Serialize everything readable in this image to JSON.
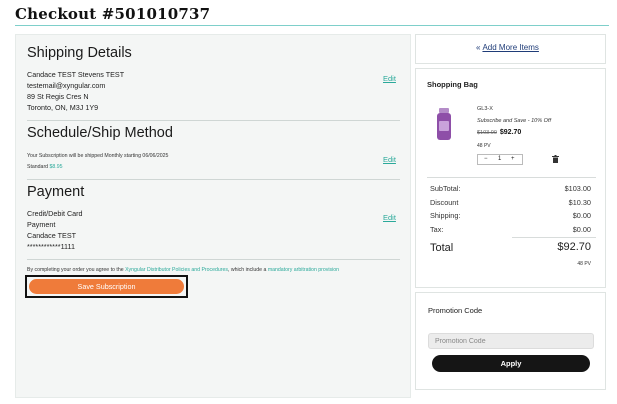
{
  "header": {
    "title": "Checkout #501010737"
  },
  "shipping": {
    "heading": "Shipping Details",
    "name": "Candace TEST Stevens TEST",
    "email": "testemail@xyngular.com",
    "street": "89 St Regis Cres N",
    "city": "Toronto, ON, M3J 1Y9",
    "edit_label": "Edit"
  },
  "schedule": {
    "heading": "Schedule/Ship Method",
    "note": "Your Subscription will be shipped Monthly starting 06/06/2025",
    "method_label": "Standard",
    "method_price": "$8.95",
    "edit_label": "Edit"
  },
  "payment": {
    "heading": "Payment",
    "type": "Credit/Debit Card",
    "label": "Payment",
    "name": "Candace TEST",
    "card": "************1111",
    "edit_label": "Edit"
  },
  "agreement": {
    "prefix": "By completing your order you agree to the",
    "link1": "Xyngular Distributor Policies and Procedures",
    "middle": ", which include a",
    "link2": "mandatory arbitration provision"
  },
  "save_button": "Save Subscription",
  "add_more": {
    "label": "Add More Items",
    "icon": "double-chevron-left-icon"
  },
  "bag": {
    "title": "Shopping Bag",
    "product": {
      "name": "GL3-X",
      "subtitle": "Subscribe and Save - 10% Off",
      "old_price": "$103.00",
      "price": "$92.70",
      "pv": "48 PV",
      "quantity": "1",
      "minus": "−",
      "plus": "+"
    },
    "summary": {
      "subtotal_label": "SubTotal:",
      "subtotal": "$103.00",
      "discount_label": "Discount",
      "discount": "$10.30",
      "shipping_label": "Shipping:",
      "shipping": "$0.00",
      "tax_label": "Tax:",
      "tax": "$0.00",
      "total_label": "Total",
      "total": "$92.70",
      "total_pv": "48 PV"
    }
  },
  "promo": {
    "title": "Promotion Code",
    "placeholder": "Promotion Code",
    "apply_label": "Apply"
  },
  "colors": {
    "accent": "#2aa99a",
    "save_button": "#ef7b3a",
    "apply_button": "#151515",
    "link_blue": "#1f3c78"
  }
}
